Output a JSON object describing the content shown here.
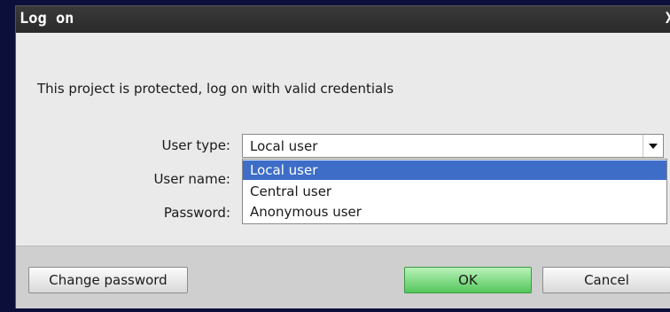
{
  "window": {
    "title": "Log on",
    "close_glyph": "X"
  },
  "message": "This project is protected, log on with valid credentials",
  "form": {
    "user_type_label": "User type:",
    "user_name_label": "User name:",
    "password_label": "Password:",
    "user_type_value": "Local user",
    "dropdown_options": [
      "Local user",
      "Central user",
      "Anonymous user"
    ],
    "selected_option_index": 0
  },
  "buttons": {
    "change_password": "Change password",
    "ok": "OK",
    "cancel": "Cancel"
  },
  "colors": {
    "title_bar": "#2f2f2f",
    "selection": "#3d6dc7",
    "ok_button": "#55c75c",
    "backdrop": "#0b0f3a"
  }
}
